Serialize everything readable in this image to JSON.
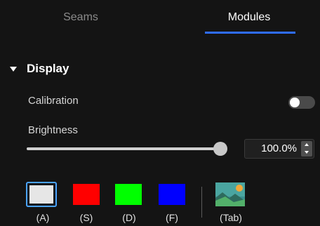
{
  "tabs": [
    {
      "label": "Seams",
      "active": false
    },
    {
      "label": "Modules",
      "active": true
    }
  ],
  "section": {
    "title": "Display",
    "expanded": true
  },
  "calibration": {
    "label": "Calibration",
    "enabled": false
  },
  "brightness": {
    "label": "Brightness",
    "value_text": "100.0%",
    "value_fraction": 1.0
  },
  "swatches": [
    {
      "label": "(A)",
      "color": "#e6e6e6",
      "selected": true
    },
    {
      "label": "(S)",
      "color": "#ff0000",
      "selected": false
    },
    {
      "label": "(D)",
      "color": "#00ff00",
      "selected": false
    },
    {
      "label": "(F)",
      "color": "#0000ff",
      "selected": false
    }
  ],
  "image_button": {
    "label": "(Tab)",
    "icon": "image-icon"
  },
  "colors": {
    "accent": "#2f6dff",
    "selection": "#4aa3ff",
    "background": "#141414"
  }
}
